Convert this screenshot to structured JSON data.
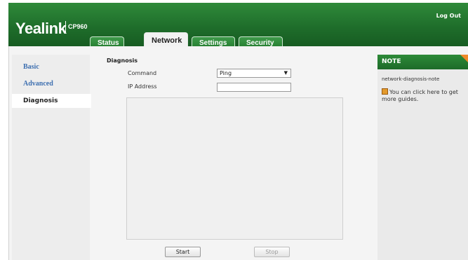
{
  "header": {
    "logo": "Yealink",
    "model": "CP960",
    "logout_label": "Log Out"
  },
  "tabs": [
    {
      "label": "Status",
      "active": false
    },
    {
      "label": "Network",
      "active": true
    },
    {
      "label": "Settings",
      "active": false
    },
    {
      "label": "Security",
      "active": false
    }
  ],
  "sidebar": {
    "items": [
      {
        "label": "Basic",
        "active": false
      },
      {
        "label": "Advanced",
        "active": false
      },
      {
        "label": "Diagnosis",
        "active": true
      }
    ]
  },
  "main": {
    "section_title": "Diagnosis",
    "command_label": "Command",
    "command_value": "Ping",
    "ip_label": "IP Address",
    "ip_value": "",
    "start_label": "Start",
    "stop_label": "Stop"
  },
  "note": {
    "title": "NOTE",
    "text": "network-diagnosis-note",
    "guide_text": "You can click here to get more guides.",
    "guide_icon": "book-icon"
  },
  "colors": {
    "header_green": "#1f6e2b",
    "link_blue": "#3d6fb0",
    "note_corner": "#f08a2a"
  }
}
